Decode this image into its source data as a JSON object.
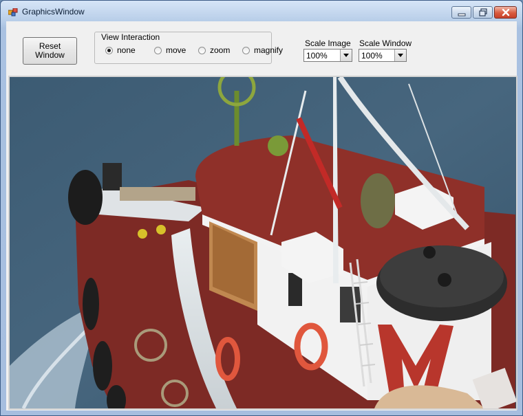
{
  "window": {
    "title": "GraphicsWindow"
  },
  "toolbar": {
    "reset_label": "Reset Window"
  },
  "view_interaction": {
    "legend": "View Interaction",
    "options": [
      {
        "label": "none",
        "selected": true
      },
      {
        "label": "move",
        "selected": false
      },
      {
        "label": "zoom",
        "selected": false
      },
      {
        "label": "magnify",
        "selected": false
      }
    ]
  },
  "scale_image": {
    "label": "Scale Image",
    "value": "100%"
  },
  "scale_window": {
    "label": "Scale Window",
    "value": "100%"
  },
  "colors": {
    "title_bar": "#b7cde8",
    "client_bg": "#f0f0f0",
    "close_button": "#d95a3e",
    "hull_red": "#8e2c26",
    "sea": "#3f5f78"
  }
}
